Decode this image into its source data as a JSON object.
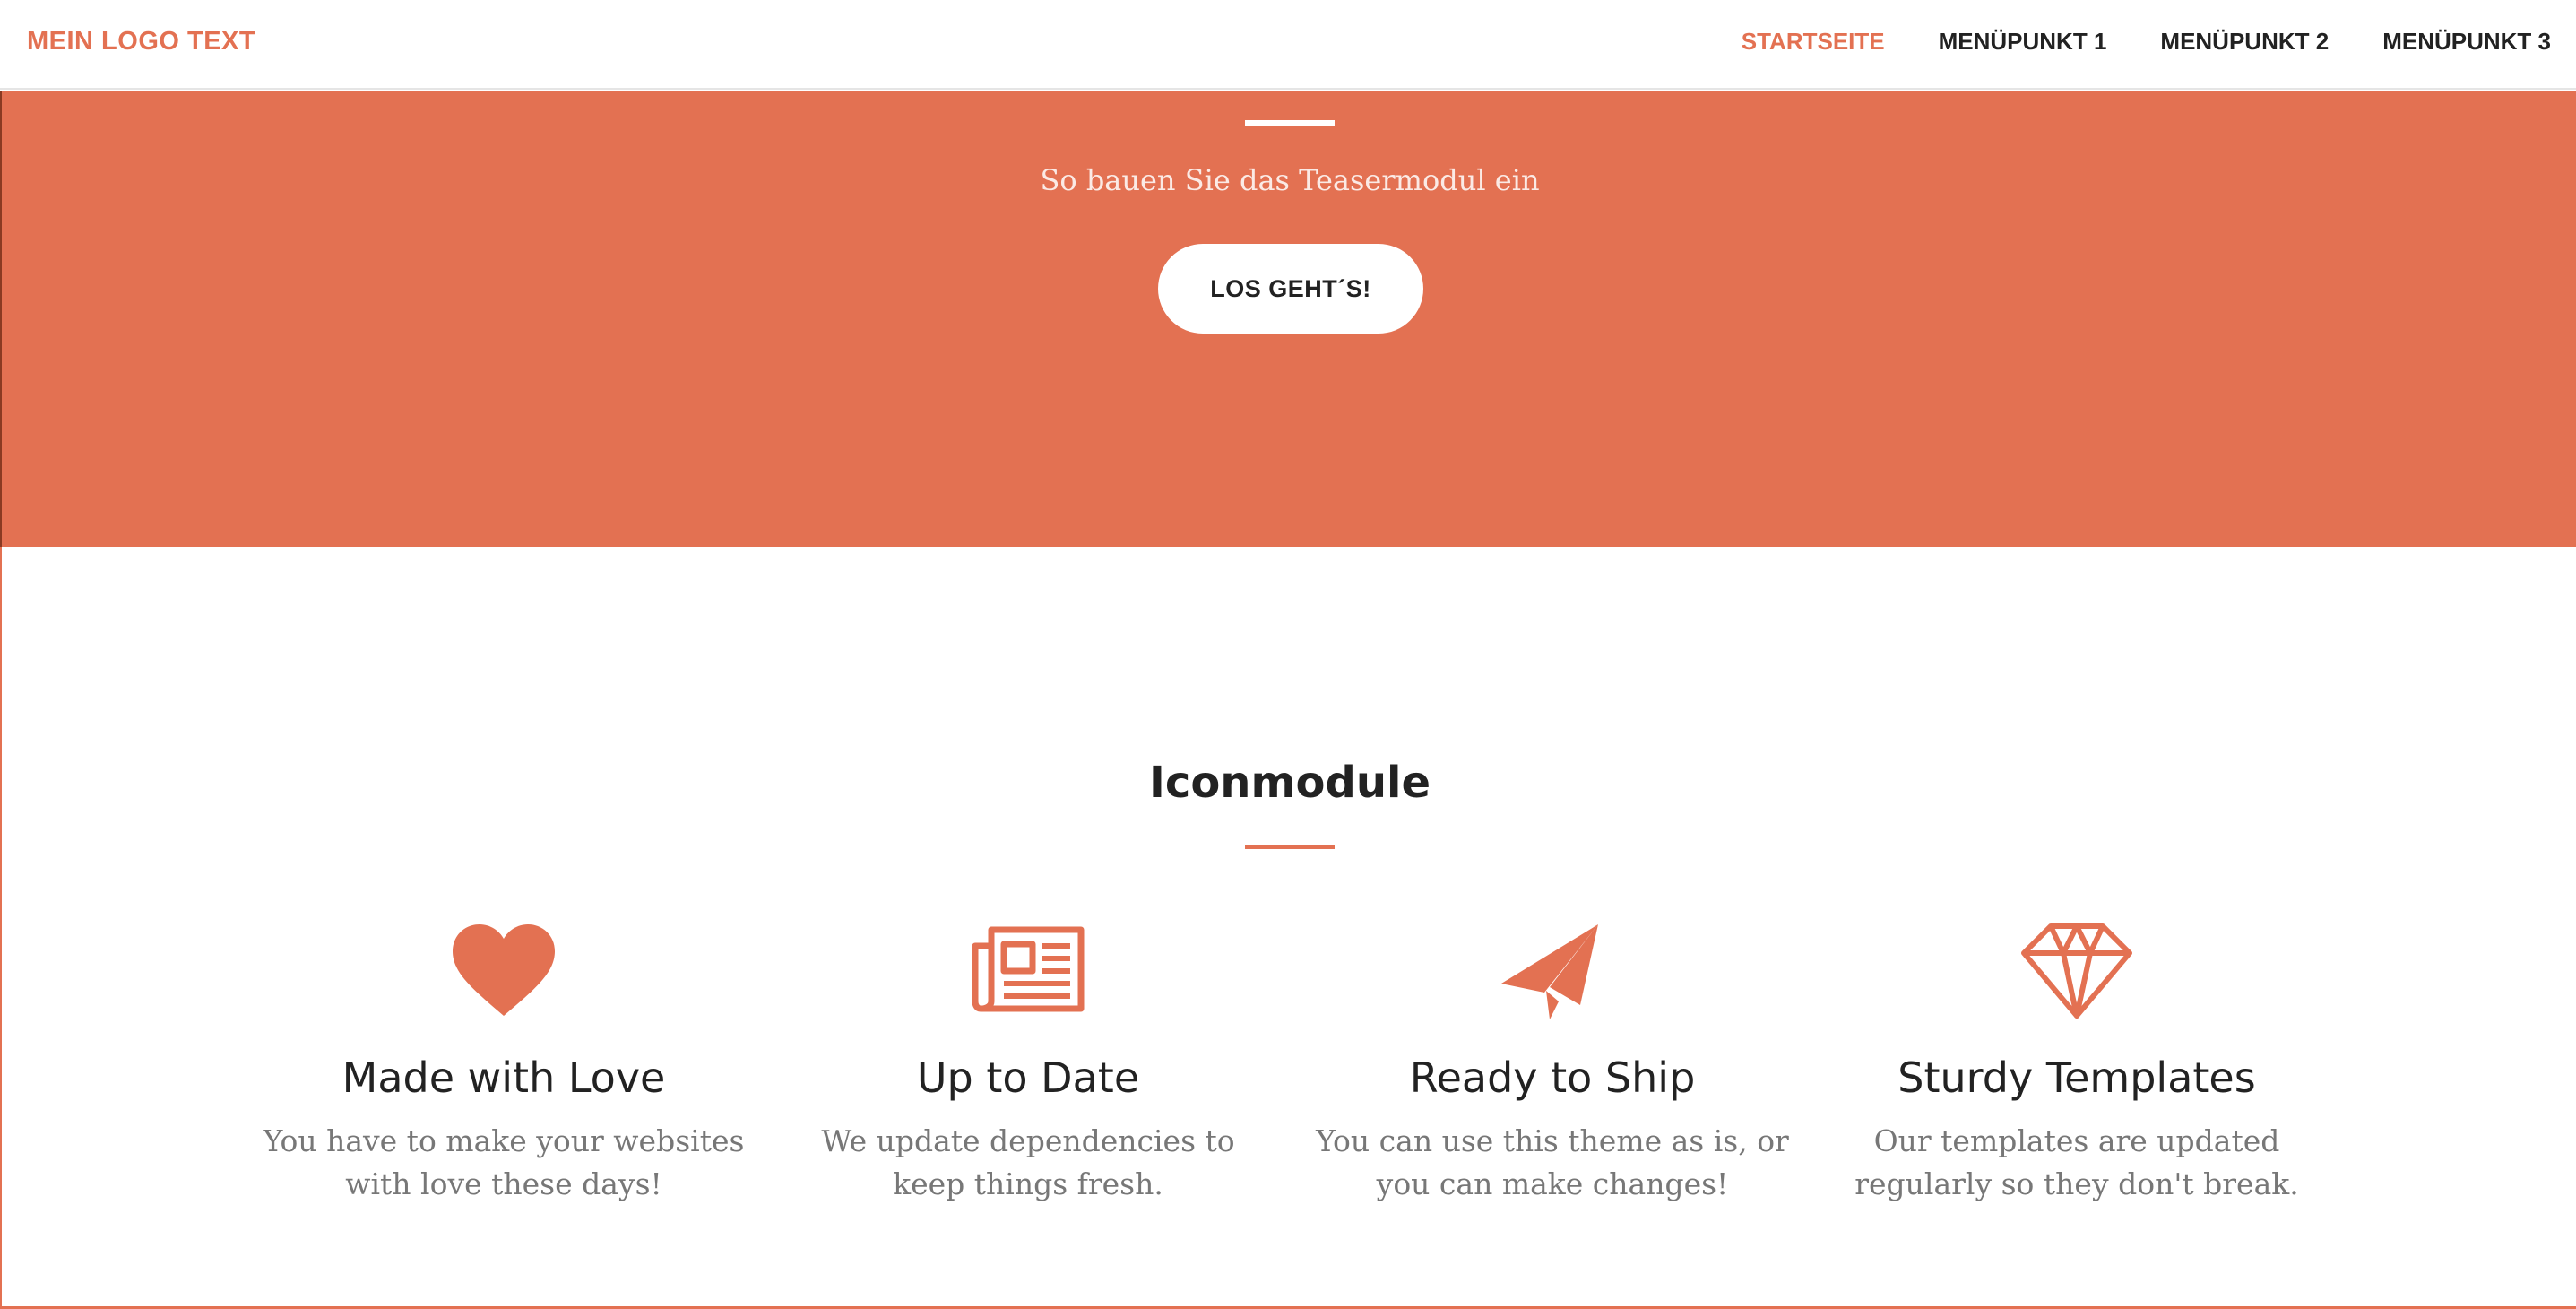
{
  "navbar": {
    "logo": "MEIN LOGO TEXT",
    "items": [
      {
        "label": "STARTSEITE",
        "active": true
      },
      {
        "label": "MENÜPUNKT 1",
        "active": false
      },
      {
        "label": "MENÜPUNKT 2",
        "active": false
      },
      {
        "label": "MENÜPUNKT 3",
        "active": false
      }
    ]
  },
  "hero": {
    "subtitle": "So bauen Sie das Teasermodul ein",
    "button_label": "LOS GEHT´S!"
  },
  "section": {
    "title": "Iconmodule",
    "features": [
      {
        "icon": "heart-icon",
        "title": "Made with Love",
        "text": "You have to make your websites with love these days!"
      },
      {
        "icon": "newspaper-icon",
        "title": "Up to Date",
        "text": "We update dependencies to keep things fresh."
      },
      {
        "icon": "paper-plane-icon",
        "title": "Ready to Ship",
        "text": "You can use this theme as is, or you can make changes!"
      },
      {
        "icon": "diamond-icon",
        "title": "Sturdy Templates",
        "text": "Our templates are updated regularly so they don't break."
      }
    ]
  },
  "colors": {
    "accent": "#e37152",
    "text_dark": "#222222",
    "text_muted": "#777777"
  }
}
